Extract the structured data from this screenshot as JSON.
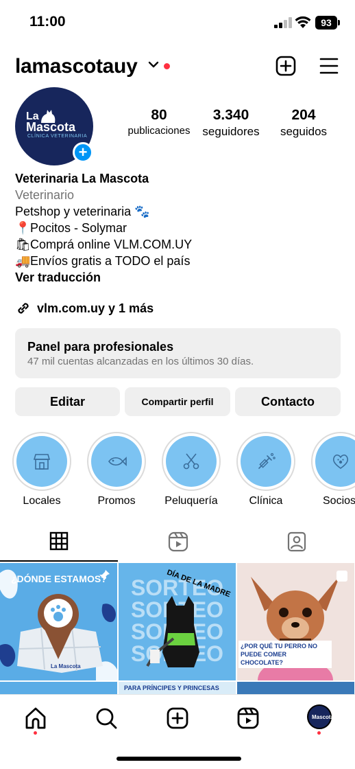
{
  "status_bar": {
    "time": "11:00",
    "battery": "93"
  },
  "header": {
    "username": "lamascotauy"
  },
  "avatar": {
    "logo_line1": "La",
    "logo_line2": "Mascota",
    "logo_line3": "CLÍNICA VETERINARIA"
  },
  "stats": [
    {
      "value": "80",
      "label": "publicaciones"
    },
    {
      "value": "3.340",
      "label": "seguidores"
    },
    {
      "value": "204",
      "label": "seguidos"
    }
  ],
  "bio": {
    "name": "Veterinaria La Mascota",
    "category": "Veterinario",
    "line1": "Petshop y veterinaria 🐾",
    "line2": "Pocitos - Solymar",
    "line3": "Comprá online VLM.COM.UY",
    "line4": "Envíos gratis a TODO el país",
    "translate": "Ver traducción"
  },
  "link": {
    "text": "vlm.com.uy y 1 más"
  },
  "pro_panel": {
    "title": "Panel para profesionales",
    "subtitle": "47 mil cuentas alcanzadas en los últimos 30 días."
  },
  "buttons": {
    "edit": "Editar",
    "share": "Compartir perfil",
    "contact": "Contacto"
  },
  "highlights": [
    {
      "label": "Locales",
      "icon": "store-icon"
    },
    {
      "label": "Promos",
      "icon": "fish-icon"
    },
    {
      "label": "Peluquería",
      "icon": "scissors-icon"
    },
    {
      "label": "Clínica",
      "icon": "syringe-icon"
    },
    {
      "label": "Socios",
      "icon": "heart-paw-icon"
    }
  ],
  "posts": [
    {
      "title": "¿DÓNDE ESTAMOS?",
      "brand": "La Mascota"
    },
    {
      "title": "SORTEO",
      "subtitle": "DÍA DE LA MADRE"
    },
    {
      "title": "¿POR QUÉ TU PERRO NO PUEDE COMER CHOCOLATE?"
    }
  ],
  "post_row2": {
    "caption": "PARA PRÍNCIPES Y PRINCESAS"
  },
  "colors": {
    "accent_blue": "#0095f6",
    "notification_red": "#ff3040",
    "highlight_blue": "#7cc3f2",
    "navy": "#17265c"
  }
}
